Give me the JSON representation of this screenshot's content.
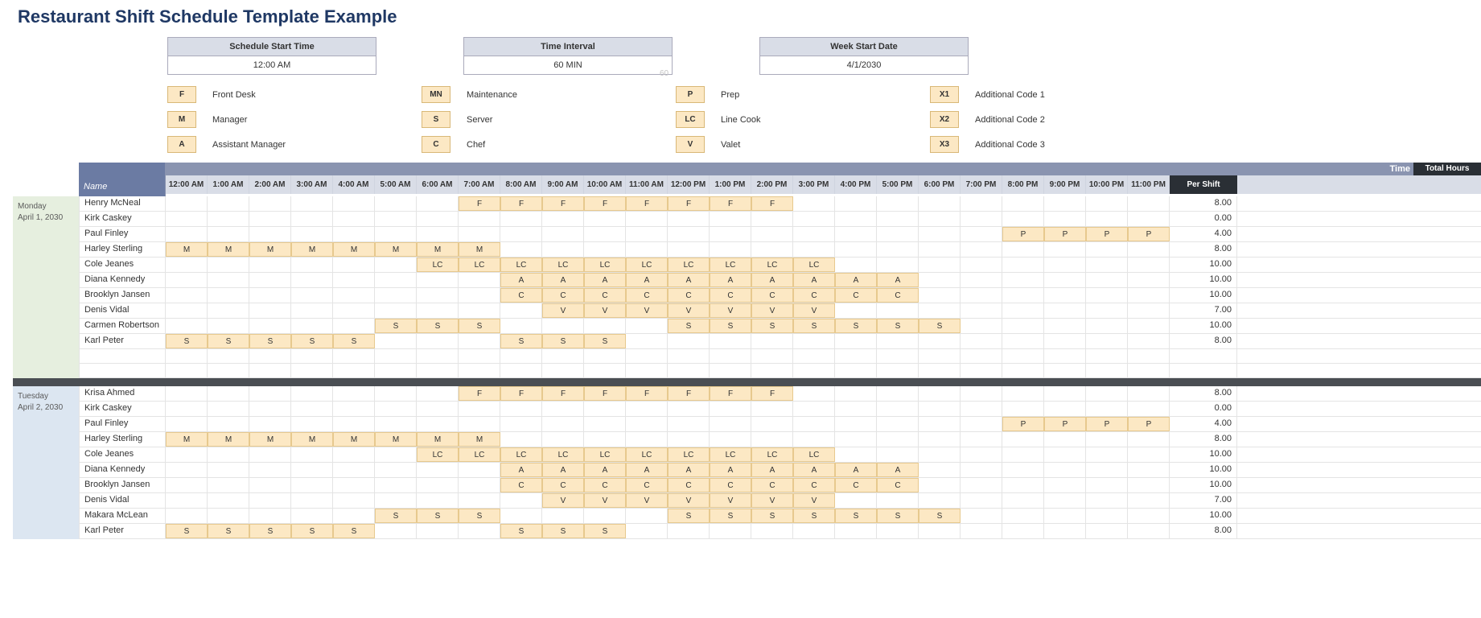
{
  "title": "Restaurant Shift Schedule Template Example",
  "config": [
    {
      "label": "Schedule Start Time",
      "value": "12:00 AM"
    },
    {
      "label": "Time Interval",
      "value": "60 MIN"
    },
    {
      "label": "Week Start Date",
      "value": "4/1/2030"
    }
  ],
  "watermark": "60",
  "legend": [
    [
      {
        "code": "F",
        "label": "Front Desk"
      },
      {
        "code": "M",
        "label": "Manager"
      },
      {
        "code": "A",
        "label": "Assistant Manager"
      }
    ],
    [
      {
        "code": "MN",
        "label": "Maintenance"
      },
      {
        "code": "S",
        "label": "Server"
      },
      {
        "code": "C",
        "label": "Chef"
      }
    ],
    [
      {
        "code": "P",
        "label": "Prep"
      },
      {
        "code": "LC",
        "label": "Line Cook"
      },
      {
        "code": "V",
        "label": "Valet"
      }
    ],
    [
      {
        "code": "X1",
        "label": "Additional Code 1"
      },
      {
        "code": "X2",
        "label": "Additional Code 2"
      },
      {
        "code": "X3",
        "label": "Additional Code 3"
      }
    ]
  ],
  "headers": {
    "name": "Name",
    "time": "Time",
    "total": "Total Hours Per Shift",
    "hours": [
      "12:00 AM",
      "1:00 AM",
      "2:00 AM",
      "3:00 AM",
      "4:00 AM",
      "5:00 AM",
      "6:00 AM",
      "7:00 AM",
      "8:00 AM",
      "9:00 AM",
      "10:00 AM",
      "11:00 AM",
      "12:00 PM",
      "1:00 PM",
      "2:00 PM",
      "3:00 PM",
      "4:00 PM",
      "5:00 PM",
      "6:00 PM",
      "7:00 PM",
      "8:00 PM",
      "9:00 PM",
      "10:00 PM",
      "11:00 PM"
    ]
  },
  "days": [
    {
      "name": "Monday",
      "date": "April 1, 2030",
      "labelClass": "mon",
      "rows": [
        {
          "name": "Henry McNeal",
          "shifts": [
            "",
            "",
            "",
            "",
            "",
            "",
            "",
            "F",
            "F",
            "F",
            "F",
            "F",
            "F",
            "F",
            "F",
            "",
            "",
            "",
            "",
            "",
            "",
            "",
            "",
            ""
          ],
          "total": "8.00"
        },
        {
          "name": "Kirk Caskey",
          "shifts": [
            "",
            "",
            "",
            "",
            "",
            "",
            "",
            "",
            "",
            "",
            "",
            "",
            "",
            "",
            "",
            "",
            "",
            "",
            "",
            "",
            "",
            "",
            "",
            ""
          ],
          "total": "0.00"
        },
        {
          "name": "Paul Finley",
          "shifts": [
            "",
            "",
            "",
            "",
            "",
            "",
            "",
            "",
            "",
            "",
            "",
            "",
            "",
            "",
            "",
            "",
            "",
            "",
            "",
            "",
            "P",
            "P",
            "P",
            "P"
          ],
          "total": "4.00"
        },
        {
          "name": "Harley Sterling",
          "shifts": [
            "M",
            "M",
            "M",
            "M",
            "M",
            "M",
            "M",
            "M",
            "",
            "",
            "",
            "",
            "",
            "",
            "",
            "",
            "",
            "",
            "",
            "",
            "",
            "",
            "",
            ""
          ],
          "total": "8.00"
        },
        {
          "name": "Cole Jeanes",
          "shifts": [
            "",
            "",
            "",
            "",
            "",
            "",
            "LC",
            "LC",
            "LC",
            "LC",
            "LC",
            "LC",
            "LC",
            "LC",
            "LC",
            "LC",
            "",
            "",
            "",
            "",
            "",
            "",
            "",
            ""
          ],
          "total": "10.00"
        },
        {
          "name": "Diana Kennedy",
          "shifts": [
            "",
            "",
            "",
            "",
            "",
            "",
            "",
            "",
            "A",
            "A",
            "A",
            "A",
            "A",
            "A",
            "A",
            "A",
            "A",
            "A",
            "",
            "",
            "",
            "",
            "",
            ""
          ],
          "total": "10.00"
        },
        {
          "name": "Brooklyn Jansen",
          "shifts": [
            "",
            "",
            "",
            "",
            "",
            "",
            "",
            "",
            "C",
            "C",
            "C",
            "C",
            "C",
            "C",
            "C",
            "C",
            "C",
            "C",
            "",
            "",
            "",
            "",
            "",
            ""
          ],
          "total": "10.00"
        },
        {
          "name": "Denis Vidal",
          "shifts": [
            "",
            "",
            "",
            "",
            "",
            "",
            "",
            "",
            "",
            "V",
            "V",
            "V",
            "V",
            "V",
            "V",
            "V",
            "",
            "",
            "",
            "",
            "",
            "",
            "",
            ""
          ],
          "total": "7.00"
        },
        {
          "name": "Carmen Robertson",
          "shifts": [
            "",
            "",
            "",
            "",
            "",
            "S",
            "S",
            "S",
            "",
            "",
            "",
            "",
            "S",
            "S",
            "S",
            "S",
            "S",
            "S",
            "S",
            "",
            "",
            "",
            "",
            ""
          ],
          "total": "10.00"
        },
        {
          "name": "Karl Peter",
          "shifts": [
            "S",
            "S",
            "S",
            "S",
            "S",
            "",
            "",
            "",
            "S",
            "S",
            "S",
            "",
            "",
            "",
            "",
            "",
            "",
            "",
            "",
            "",
            "",
            "",
            "",
            ""
          ],
          "total": "8.00"
        },
        {
          "name": "",
          "shifts": [
            "",
            "",
            "",
            "",
            "",
            "",
            "",
            "",
            "",
            "",
            "",
            "",
            "",
            "",
            "",
            "",
            "",
            "",
            "",
            "",
            "",
            "",
            "",
            ""
          ],
          "total": ""
        },
        {
          "name": "",
          "shifts": [
            "",
            "",
            "",
            "",
            "",
            "",
            "",
            "",
            "",
            "",
            "",
            "",
            "",
            "",
            "",
            "",
            "",
            "",
            "",
            "",
            "",
            "",
            "",
            ""
          ],
          "total": ""
        }
      ]
    },
    {
      "name": "Tuesday",
      "date": "April 2, 2030",
      "labelClass": "tue",
      "rows": [
        {
          "name": "Krisa Ahmed",
          "shifts": [
            "",
            "",
            "",
            "",
            "",
            "",
            "",
            "F",
            "F",
            "F",
            "F",
            "F",
            "F",
            "F",
            "F",
            "",
            "",
            "",
            "",
            "",
            "",
            "",
            "",
            ""
          ],
          "total": "8.00"
        },
        {
          "name": "Kirk Caskey",
          "shifts": [
            "",
            "",
            "",
            "",
            "",
            "",
            "",
            "",
            "",
            "",
            "",
            "",
            "",
            "",
            "",
            "",
            "",
            "",
            "",
            "",
            "",
            "",
            "",
            ""
          ],
          "total": "0.00"
        },
        {
          "name": "Paul Finley",
          "shifts": [
            "",
            "",
            "",
            "",
            "",
            "",
            "",
            "",
            "",
            "",
            "",
            "",
            "",
            "",
            "",
            "",
            "",
            "",
            "",
            "",
            "P",
            "P",
            "P",
            "P"
          ],
          "total": "4.00"
        },
        {
          "name": "Harley Sterling",
          "shifts": [
            "M",
            "M",
            "M",
            "M",
            "M",
            "M",
            "M",
            "M",
            "",
            "",
            "",
            "",
            "",
            "",
            "",
            "",
            "",
            "",
            "",
            "",
            "",
            "",
            "",
            ""
          ],
          "total": "8.00"
        },
        {
          "name": "Cole Jeanes",
          "shifts": [
            "",
            "",
            "",
            "",
            "",
            "",
            "LC",
            "LC",
            "LC",
            "LC",
            "LC",
            "LC",
            "LC",
            "LC",
            "LC",
            "LC",
            "",
            "",
            "",
            "",
            "",
            "",
            "",
            ""
          ],
          "total": "10.00"
        },
        {
          "name": "Diana Kennedy",
          "shifts": [
            "",
            "",
            "",
            "",
            "",
            "",
            "",
            "",
            "A",
            "A",
            "A",
            "A",
            "A",
            "A",
            "A",
            "A",
            "A",
            "A",
            "",
            "",
            "",
            "",
            "",
            ""
          ],
          "total": "10.00"
        },
        {
          "name": "Brooklyn Jansen",
          "shifts": [
            "",
            "",
            "",
            "",
            "",
            "",
            "",
            "",
            "C",
            "C",
            "C",
            "C",
            "C",
            "C",
            "C",
            "C",
            "C",
            "C",
            "",
            "",
            "",
            "",
            "",
            ""
          ],
          "total": "10.00"
        },
        {
          "name": "Denis Vidal",
          "shifts": [
            "",
            "",
            "",
            "",
            "",
            "",
            "",
            "",
            "",
            "V",
            "V",
            "V",
            "V",
            "V",
            "V",
            "V",
            "",
            "",
            "",
            "",
            "",
            "",
            "",
            ""
          ],
          "total": "7.00"
        },
        {
          "name": "Makara McLean",
          "shifts": [
            "",
            "",
            "",
            "",
            "",
            "S",
            "S",
            "S",
            "",
            "",
            "",
            "",
            "S",
            "S",
            "S",
            "S",
            "S",
            "S",
            "S",
            "",
            "",
            "",
            "",
            ""
          ],
          "total": "10.00"
        },
        {
          "name": "Karl Peter",
          "shifts": [
            "S",
            "S",
            "S",
            "S",
            "S",
            "",
            "",
            "",
            "S",
            "S",
            "S",
            "",
            "",
            "",
            "",
            "",
            "",
            "",
            "",
            "",
            "",
            "",
            "",
            ""
          ],
          "total": "8.00"
        }
      ]
    }
  ]
}
